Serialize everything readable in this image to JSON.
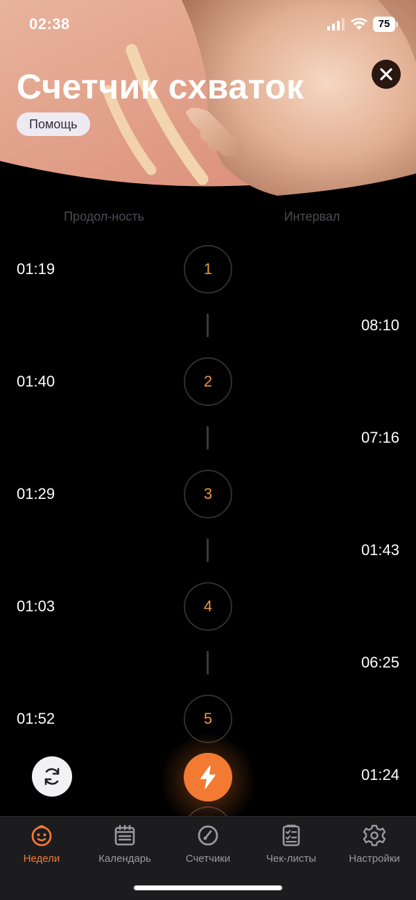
{
  "status_bar": {
    "time": "02:38",
    "battery": "75"
  },
  "header": {
    "title": "Счетчик схваток",
    "help_label": "Помощь"
  },
  "columns": {
    "duration": "Продол-ность",
    "interval": "Интервал"
  },
  "contractions": [
    {
      "number": "1",
      "duration": "01:19"
    },
    {
      "number": "2",
      "duration": "01:40"
    },
    {
      "number": "3",
      "duration": "01:29"
    },
    {
      "number": "4",
      "duration": "01:03"
    },
    {
      "number": "5",
      "duration": "01:52"
    }
  ],
  "intervals": [
    "08:10",
    "07:16",
    "01:43",
    "06:25",
    "01:24"
  ],
  "tabs": [
    {
      "label": "Недели",
      "icon": "baby-face-icon",
      "active": true
    },
    {
      "label": "Календарь",
      "icon": "calendar-icon",
      "active": false
    },
    {
      "label": "Счетчики",
      "icon": "gauge-icon",
      "active": false
    },
    {
      "label": "Чек-листы",
      "icon": "checklist-icon",
      "active": false
    },
    {
      "label": "Настройки",
      "icon": "gear-icon",
      "active": false
    }
  ],
  "colors": {
    "accent": "#f27a32",
    "number": "#f0953b",
    "muted": "#4c4c54"
  }
}
